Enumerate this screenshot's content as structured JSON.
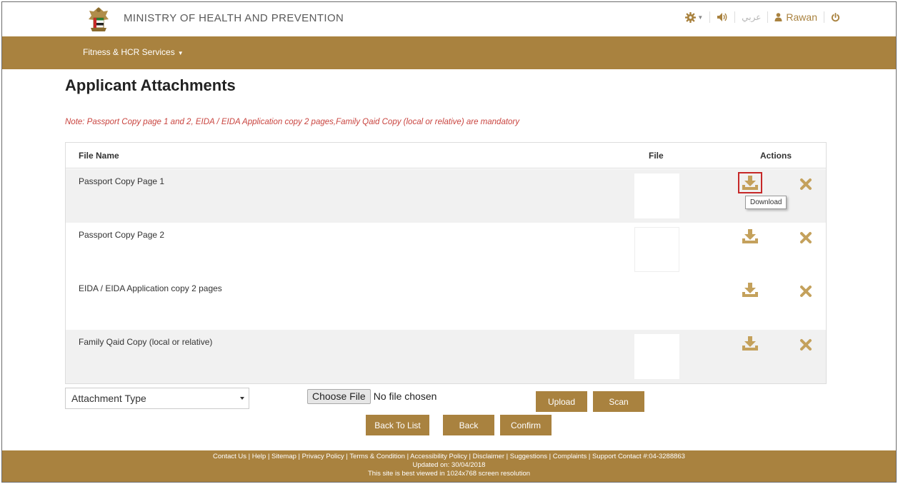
{
  "header": {
    "ministry_name": "MINISTRY OF HEALTH AND PREVENTION",
    "emblem_icon": "uae-emblem-icon",
    "settings_icon": "gear-icon",
    "audio_icon": "speaker-icon",
    "language_label": "عربي",
    "user_icon": "user-icon",
    "username": "Rawan",
    "power_icon": "power-icon"
  },
  "nav": {
    "menu_label": "Fitness & HCR Services"
  },
  "page": {
    "title": "Applicant Attachments",
    "note": "Note: Passport Copy page 1 and 2, EIDA / EIDA Application copy 2 pages,Family Qaid Copy (local or relative) are mandatory"
  },
  "table": {
    "headers": {
      "file_name": "File Name",
      "file": "File",
      "actions": "Actions"
    },
    "rows": [
      {
        "name": "Passport Copy Page 1",
        "has_thumbnail": true
      },
      {
        "name": "Passport Copy Page 2",
        "has_thumbnail": true
      },
      {
        "name": "EIDA / EIDA Application copy 2 pages",
        "has_thumbnail": false
      },
      {
        "name": "Family Qaid Copy (local or relative)",
        "has_thumbnail": true
      }
    ],
    "tooltip": "Download"
  },
  "controls": {
    "attachment_type": "Attachment Type",
    "choose_file": "Choose File",
    "no_file": "No file chosen",
    "upload": "Upload",
    "scan": "Scan",
    "back_to_list": "Back To List",
    "back": "Back",
    "confirm": "Confirm"
  },
  "footer": {
    "links": "Contact Us | Help | Sitemap | Privacy Policy | Terms & Condition | Accessibility Policy | Disclaimer | Suggestions | Complaints |  Support Contact #:04-3288863",
    "updated": "Updated on: 30/04/2018",
    "resolution": "This site is best viewed in 1024x768 screen resolution"
  },
  "colors": {
    "brand_gold": "#a9823f",
    "note_red": "#c9443f",
    "highlight_red": "#c62828",
    "row_alt": "#f1f1f1"
  }
}
